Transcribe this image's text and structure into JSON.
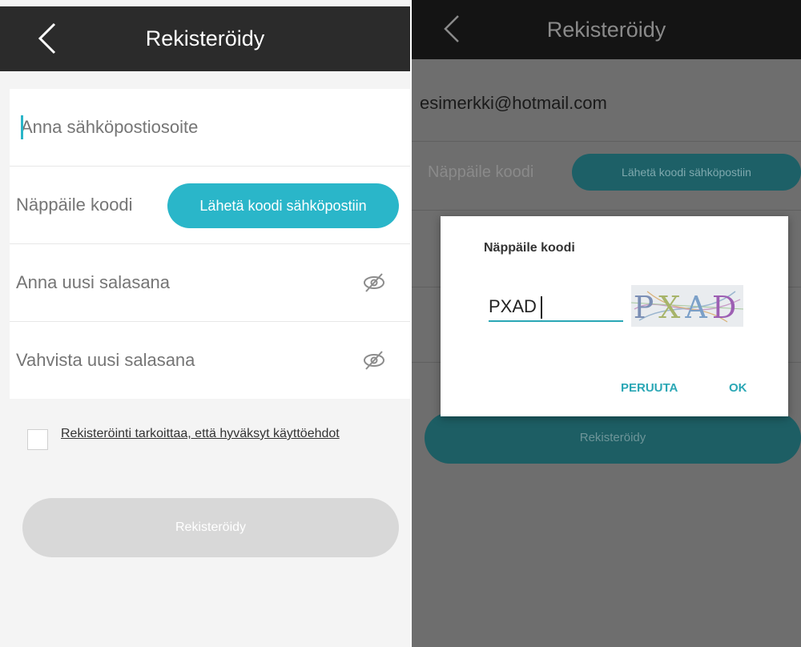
{
  "left": {
    "header": {
      "title": "Rekisteröidy",
      "back_icon": "chevron-left-icon"
    },
    "form": {
      "email_placeholder": "Anna sähköpostiosoite",
      "code_placeholder": "Näppäile koodi",
      "send_code_label": "Lähetä koodi sähköpostiin",
      "password_placeholder": "Anna uusi salasana",
      "confirm_password_placeholder": "Vahvista uusi salasana",
      "password_toggle_icon": "eye-off-icon"
    },
    "agreement": {
      "checked": false,
      "text": "Rekisteröinti tarkoittaa, että hyväksyt käyttöehdot"
    },
    "register_label": "Rekisteröidy"
  },
  "right": {
    "header": {
      "title": "Rekisteröidy",
      "back_icon": "chevron-left-icon"
    },
    "email_value": "esimerkki@hotmail.com",
    "code_placeholder": "Näppäile koodi",
    "send_code_label": "Lähetä koodi sähköpostiin",
    "register_label": "Rekisteröidy",
    "dialog": {
      "title": "Näppäile koodi",
      "input_value": "PXAD",
      "captcha_image_text": "PXAD",
      "cancel_label": "PERUUTA",
      "ok_label": "OK"
    }
  },
  "colors": {
    "accent": "#2ab6c9",
    "header_bg": "#2b2b2b",
    "disabled_button": "#d8d8d8",
    "overlay": "#6e6e6e"
  }
}
